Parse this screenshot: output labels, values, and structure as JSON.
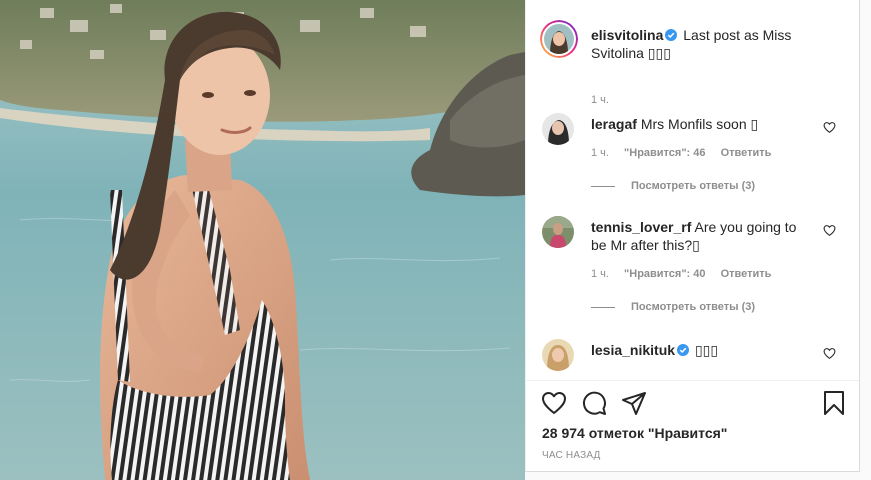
{
  "post": {
    "author": "elisvitolina",
    "caption": "Last post as Miss Svitolina ▯▯▯",
    "time": "1 ч."
  },
  "comments": [
    {
      "user": "leragaf",
      "text": "Mrs Monfils soon ▯",
      "time": "1 ч.",
      "likes": "\"Нравится\": 46",
      "reply": "Ответить",
      "view_replies": "Посмотреть ответы (3)",
      "verified": false
    },
    {
      "user": "tennis_lover_rf",
      "text": "Are you going to be Mr after this?▯",
      "time": "1 ч.",
      "likes": "\"Нравится\": 40",
      "reply": "Ответить",
      "view_replies": "Посмотреть ответы (3)",
      "verified": false
    },
    {
      "user": "lesia_nikituk",
      "text": "▯▯▯",
      "verified": true
    }
  ],
  "actions": {
    "icons": [
      "heart-icon",
      "comment-icon",
      "share-icon",
      "bookmark-icon"
    ],
    "likes_text": "28 974 отметок \"Нравится\"",
    "posted_label": "ЧАС НАЗАД"
  },
  "colors": {
    "verified": "#3897f0",
    "muted": "#8e8e8e",
    "text": "#262626"
  }
}
